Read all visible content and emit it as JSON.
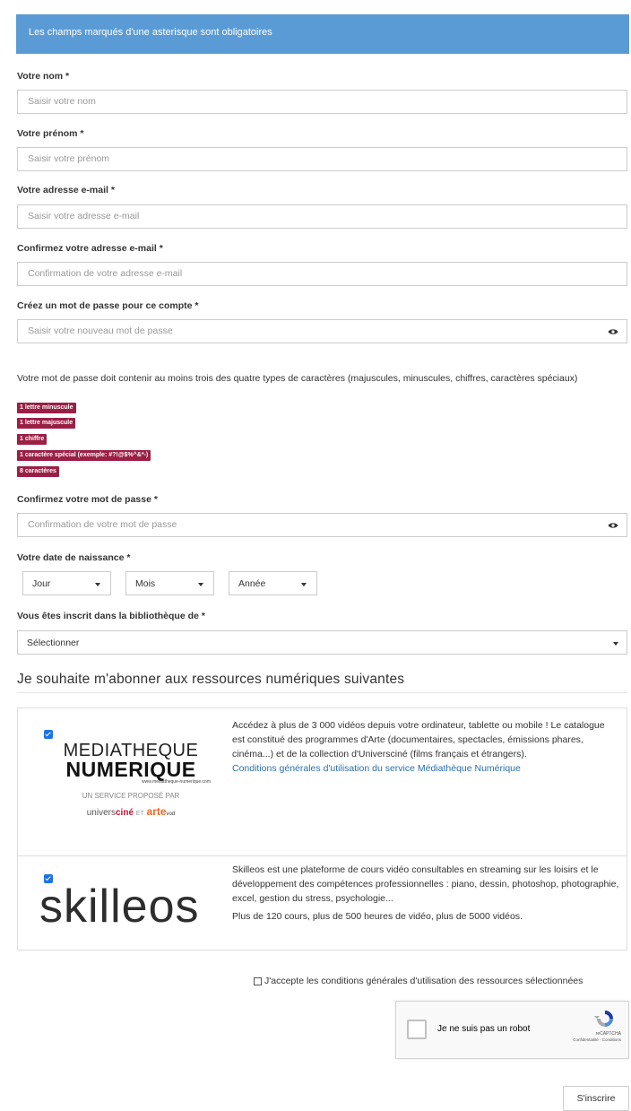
{
  "banner": "Les champs marqués d'une asterisque sont obligatoires",
  "fields": {
    "nom": {
      "label": "Votre nom *",
      "placeholder": "Saisir votre nom"
    },
    "prenom": {
      "label": "Votre prénom *",
      "placeholder": "Saisir votre prénom"
    },
    "email": {
      "label": "Votre adresse e-mail *",
      "placeholder": "Saisir votre adresse e-mail"
    },
    "email_confirm": {
      "label": "Confirmez votre adresse e-mail *",
      "placeholder": "Confirmation de votre adresse e-mail"
    },
    "password": {
      "label": "Créez un mot de passe pour ce compte *",
      "placeholder": "Saisir votre nouveau mot de passe"
    },
    "password_confirm": {
      "label": "Confirmez votre mot de passe *",
      "placeholder": "Confirmation de votre mot de passe"
    }
  },
  "password_help": "Votre mot de passe doit contenir au moins trois des quatre types de caractères (majuscules, minuscules, chiffres, caractères spéciaux)",
  "password_rules": [
    "1 lettre minuscule",
    "1 lettre majuscule",
    "1 chiffre",
    "1 caractère spécial (exemple: #?!@$%^&*-)",
    "8 caractères"
  ],
  "birth": {
    "label": "Votre date de naissance *",
    "day": "Jour",
    "month": "Mois",
    "year": "Année"
  },
  "library": {
    "label": "Vous êtes inscrit dans la bibliothèque de *",
    "value": "Sélectionner"
  },
  "section_title": "Je souhaite m'abonner aux ressources numériques suivantes",
  "resources": {
    "mediatheque": {
      "logo_line1": "MEDIATHEQUE",
      "logo_line2": "NUMERIQUE",
      "logo_url": "www.mediatheque-numerique.com",
      "logo_service": "UN SERVICE PROPOSÉ PAR",
      "logo_univers": "univers",
      "logo_cine": "ciné",
      "logo_et": "ET",
      "logo_arte": "arte",
      "logo_vod": "vod",
      "description": "Accédez à plus de 3 000 vidéos depuis votre ordinateur, tablette ou mobile ! Le catalogue est constitué des programmes d'Arte (documentaires, spectacles, émissions phares, cinéma...) et de la collection d'Universciné (films français et étrangers).",
      "link": "Conditions générales d'utilisation du service Médiathèque Numérique"
    },
    "skilleos": {
      "logo": "skilleos",
      "description": "Skilleos est une plateforme de cours vidéo consultables en streaming sur les loisirs et le développement des compétences professionnelles : piano, dessin, photoshop, photographie, excel, gestion du stress, psychologie...",
      "stats": "Plus de 120 cours, plus de 500 heures de vidéo, plus de 5000 vidéos."
    }
  },
  "terms": "J'accepte les conditions générales d'utilisation des ressources sélectionnées",
  "recaptcha": {
    "label": "Je ne suis pas un robot",
    "brand": "reCAPTCHA",
    "links": "Confidentialité - Conditions"
  },
  "submit": "S'inscrire",
  "colors": {
    "banner": "#5b9bd5",
    "badge": "#9b1f45",
    "link": "#2a6fb0",
    "checkbox": "#1a73e8"
  }
}
